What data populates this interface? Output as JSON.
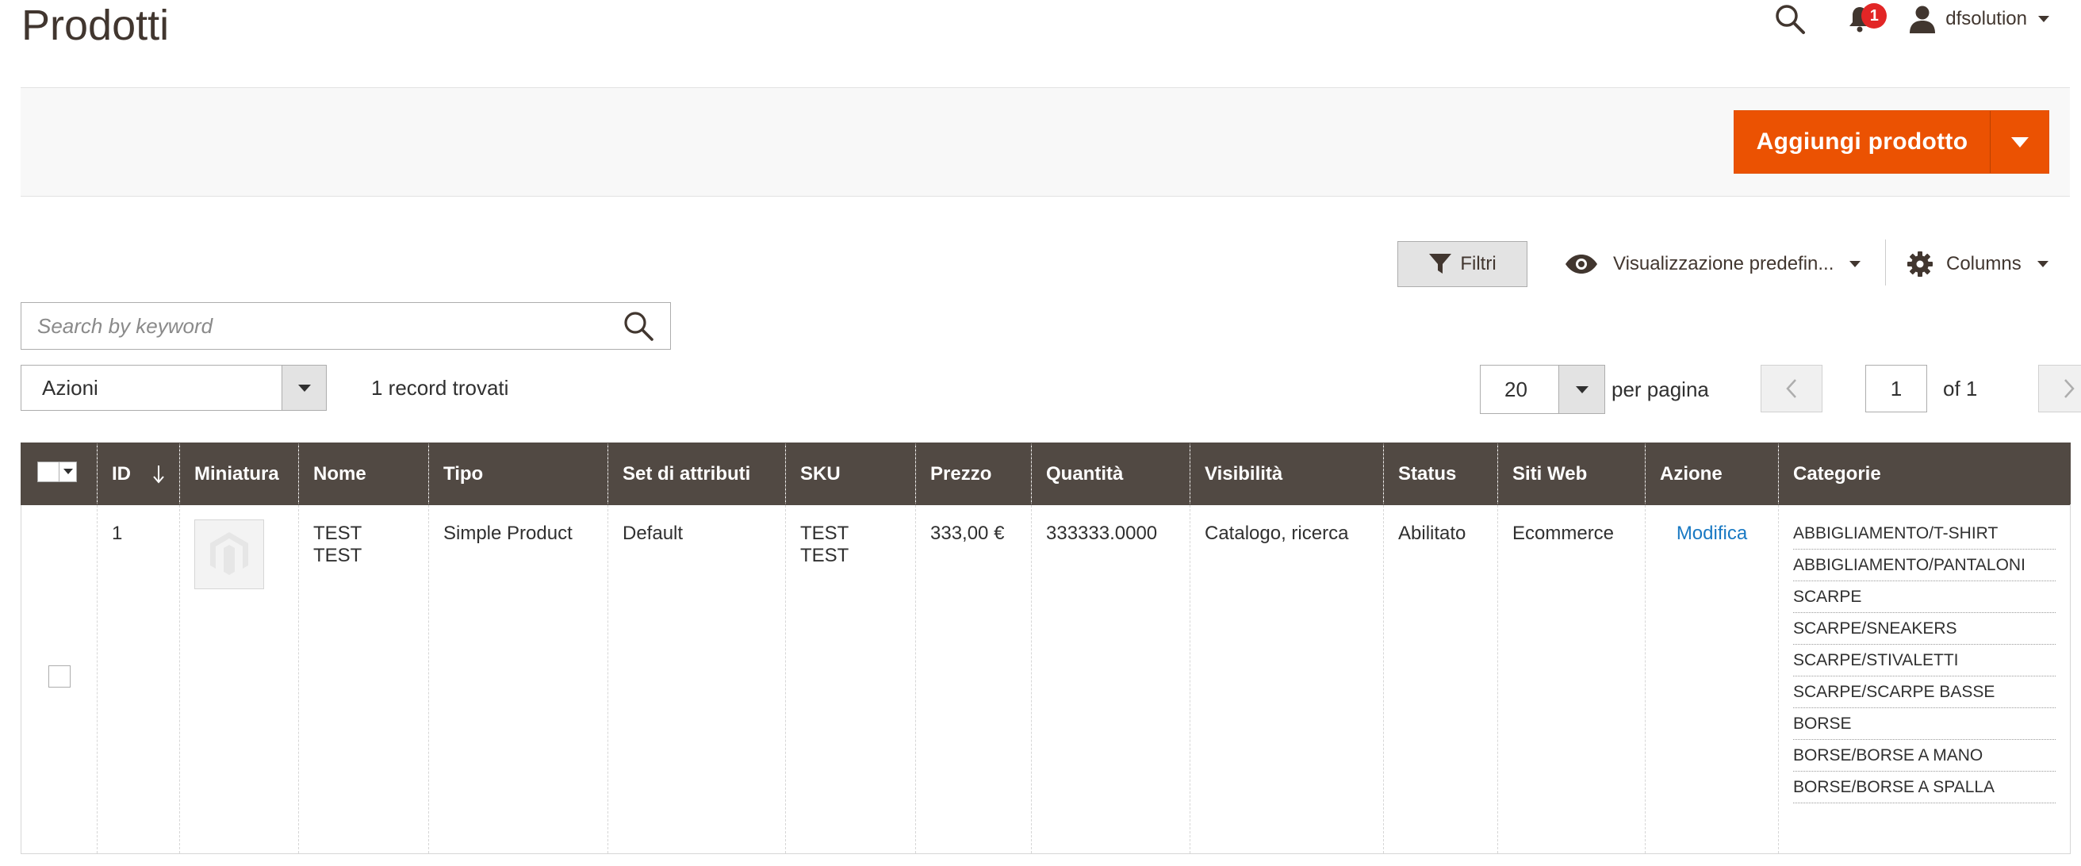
{
  "header": {
    "title": "Prodotti",
    "notifications_count": "1",
    "username": "dfsolution"
  },
  "action_bar": {
    "add_product_label": "Aggiungi prodotto"
  },
  "toolbar": {
    "filters_label": "Filtri",
    "view_label": "Visualizzazione predefin...",
    "columns_label": "Columns",
    "search_placeholder": "Search by keyword",
    "actions_label": "Azioni",
    "records_found": "1 record trovati",
    "per_page_value": "20",
    "per_page_label": "per pagina",
    "current_page": "1",
    "total_pages": "of 1"
  },
  "table": {
    "columns": [
      "ID",
      "Miniatura",
      "Nome",
      "Tipo",
      "Set di attributi",
      "SKU",
      "Prezzo",
      "Quantità",
      "Visibilità",
      "Status",
      "Siti Web",
      "Azione",
      "Categorie"
    ],
    "rows": [
      {
        "id": "1",
        "name": "TEST TEST",
        "type": "Simple Product",
        "attribute_set": "Default",
        "sku": "TEST TEST",
        "price": "333,00 €",
        "quantity": "333333.0000",
        "visibility": "Catalogo, ricerca",
        "status": "Abilitato",
        "websites": "Ecommerce",
        "action": "Modifica",
        "categories": [
          "ABBIGLIAMENTO/T-SHIRT",
          "ABBIGLIAMENTO/PANTALONI",
          "SCARPE",
          "SCARPE/SNEAKERS",
          "SCARPE/STIVALETTI",
          "SCARPE/SCARPE BASSE",
          "BORSE",
          "BORSE/BORSE A MANO",
          "BORSE/BORSE A SPALLA"
        ]
      }
    ]
  },
  "colors": {
    "accent": "#eb5202",
    "table_header": "#514943",
    "link": "#1979c3",
    "badge": "#e22626"
  },
  "icons": [
    "search-icon",
    "bell-icon",
    "user-icon",
    "filter-icon",
    "eye-icon",
    "gear-icon",
    "chevron-left-icon",
    "chevron-right-icon",
    "sort-arrow-icon",
    "magento-placeholder-icon"
  ]
}
